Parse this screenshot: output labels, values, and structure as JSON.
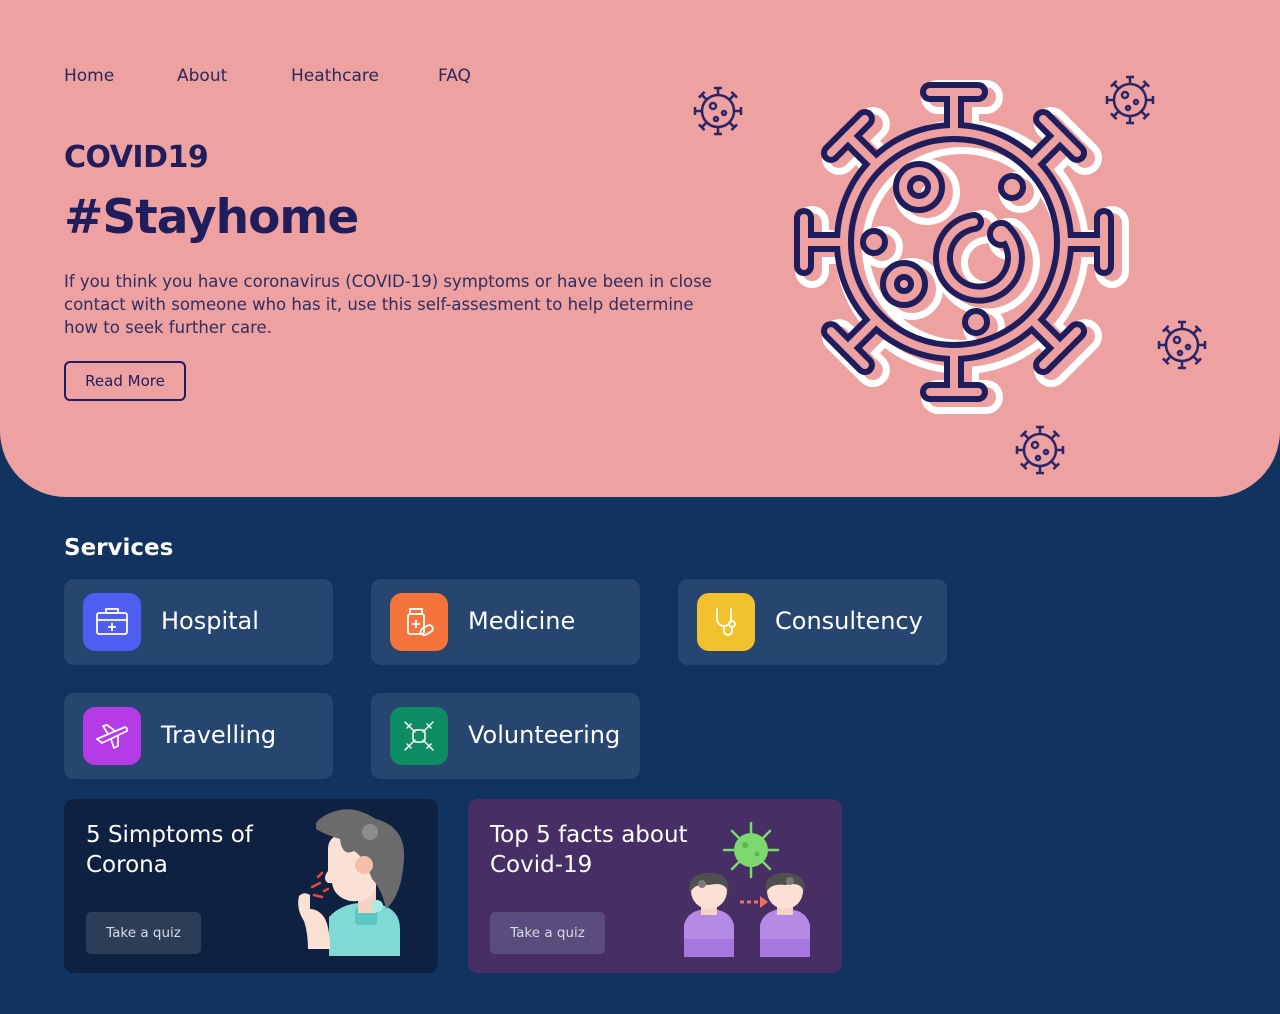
{
  "nav": {
    "items": [
      "Home",
      "About",
      "Heathcare",
      "FAQ"
    ]
  },
  "hero": {
    "kicker": "COVID19",
    "headline": "#Stayhome",
    "description": "If you think you have coronavirus (COVID-19) symptoms or have been in close contact with someone who has it, use this self-assesment to help determine how to seek further care.",
    "cta_label": "Read More"
  },
  "services": {
    "title": "Services",
    "items": [
      {
        "label": "Hospital",
        "icon": "first-aid-kit-icon",
        "color": "#4f5ef0"
      },
      {
        "label": "Medicine",
        "icon": "medicine-bottle-icon",
        "color": "#f4743c"
      },
      {
        "label": "Consultency",
        "icon": "stethoscope-icon",
        "color": "#f2c22e"
      },
      {
        "label": "Travelling",
        "icon": "airplane-icon",
        "color": "#b43be6"
      },
      {
        "label": "Volunteering",
        "icon": "volunteer-hands-icon",
        "color": "#0e8c63"
      }
    ]
  },
  "cards": [
    {
      "title": "5 Simptoms of Corona",
      "button": "Take a quiz",
      "bg": "#0f2140",
      "button_bg": "#2c3d58",
      "illustration": "coughing-person-illustration"
    },
    {
      "title": "Top 5 facts about Covid-19",
      "button": "Take a quiz",
      "bg": "#472f66",
      "button_bg": "#5a4c7c",
      "illustration": "virus-transmission-illustration"
    }
  ],
  "colors": {
    "hero_bg": "#eea1a1",
    "page_bg": "#10335f",
    "primary_text": "#1f1d5b",
    "service_card_bg": "#27466f"
  }
}
